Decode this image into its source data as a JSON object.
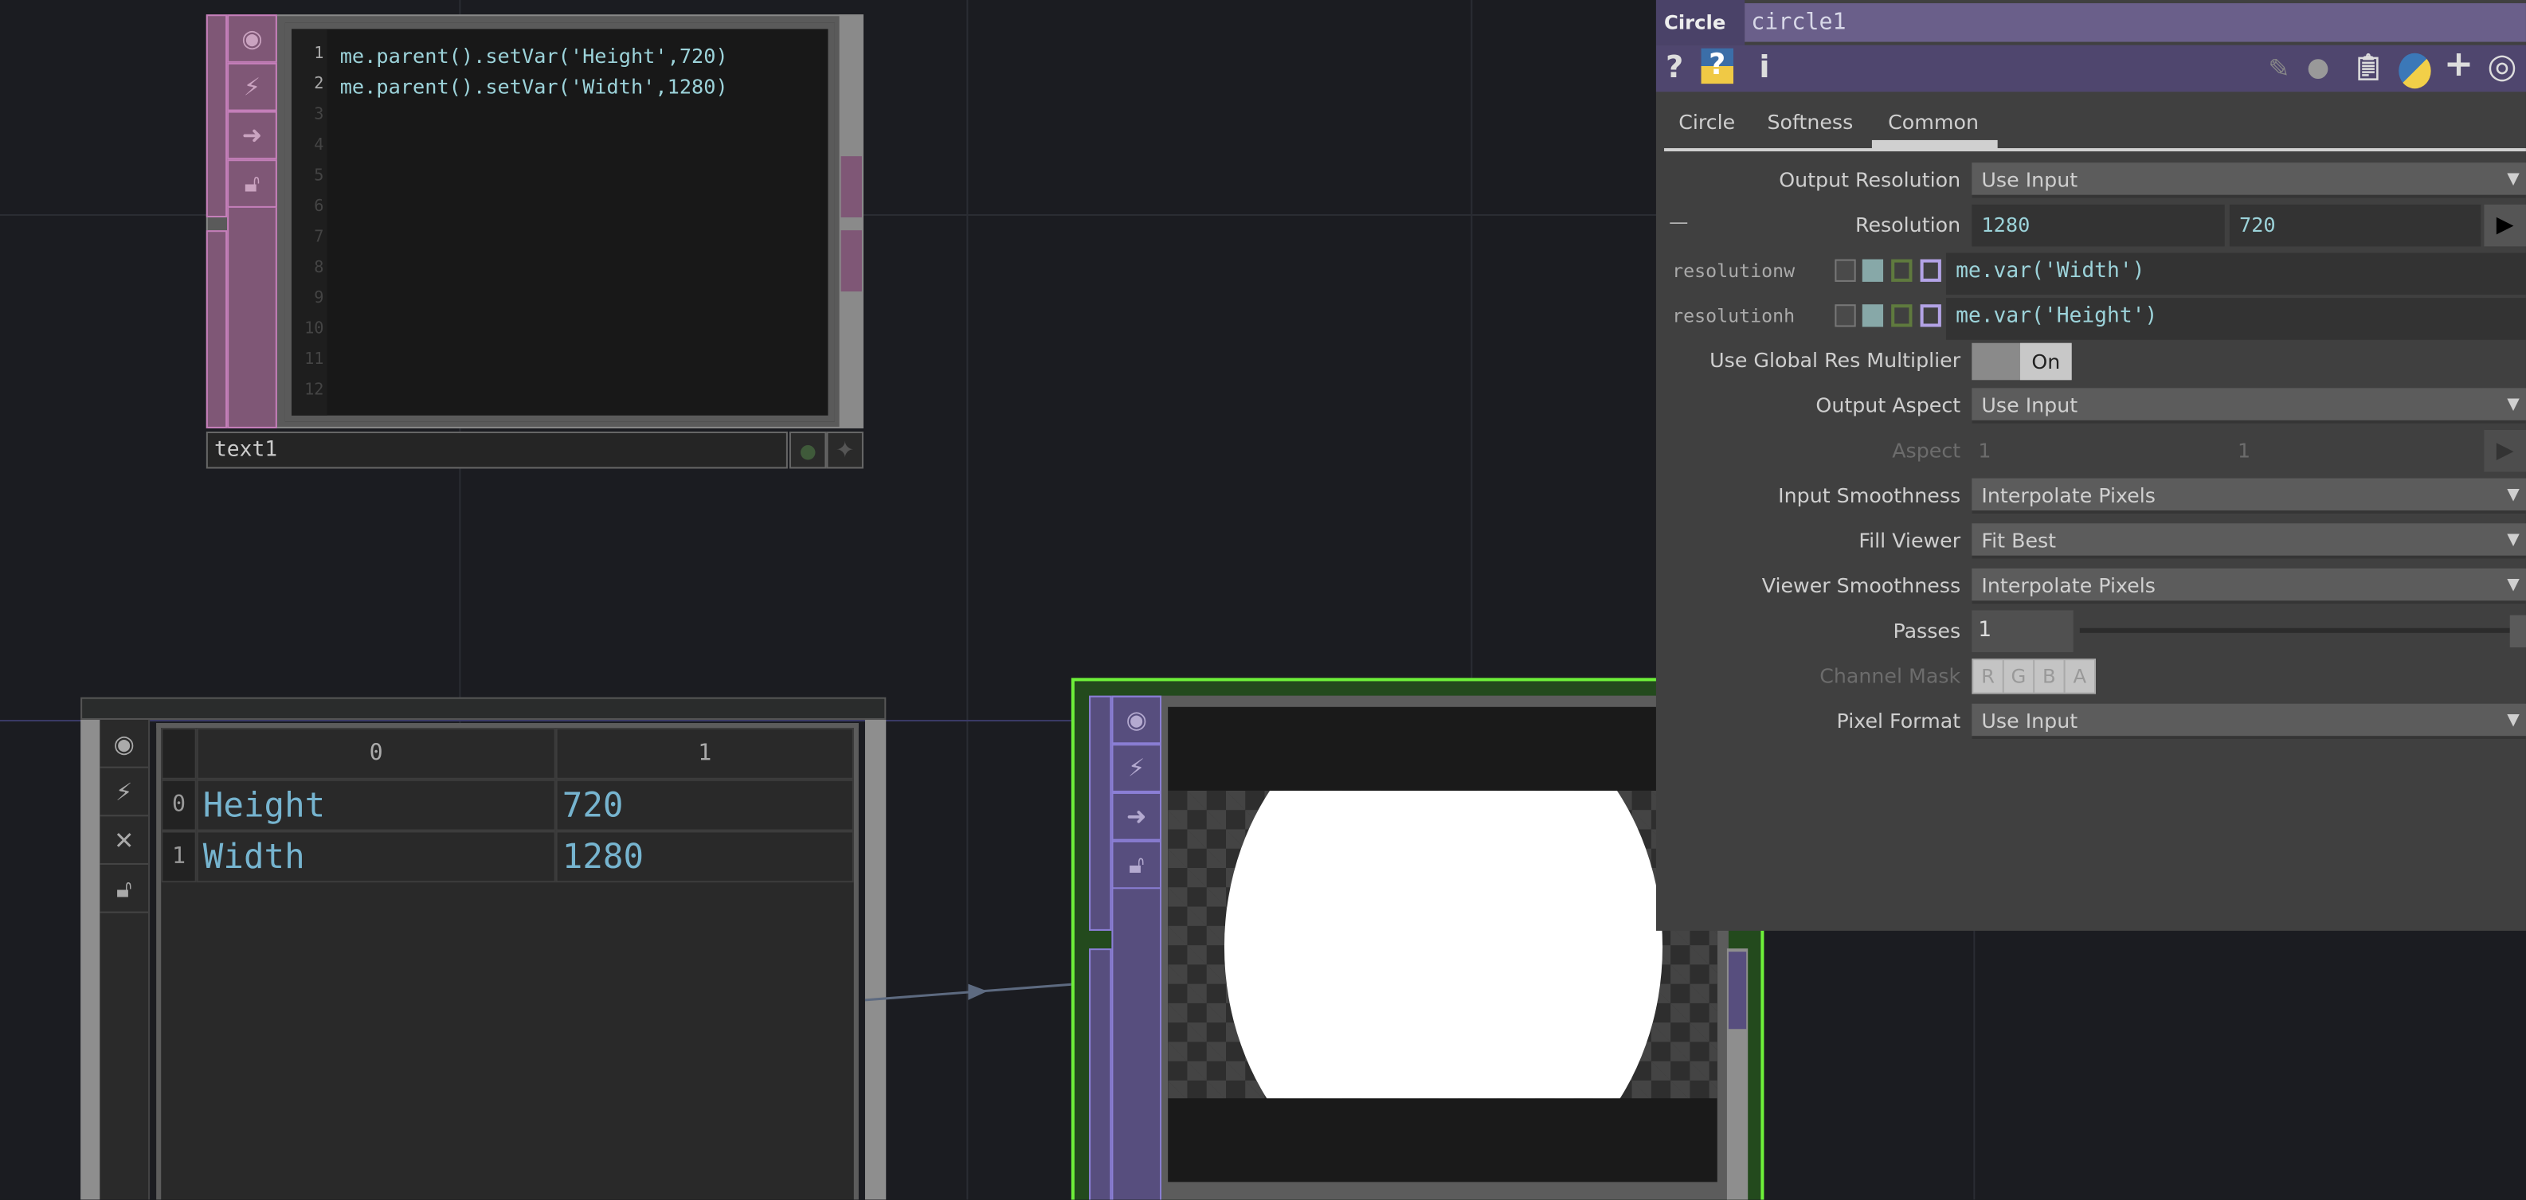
{
  "text_node": {
    "name": "text1",
    "line_numbers": [
      "1",
      "2",
      "3",
      "4",
      "5",
      "6",
      "7",
      "8",
      "9",
      "10",
      "11",
      "12"
    ],
    "lines": [
      "me.parent().setVar('Height',720)",
      "me.parent().setVar('Width',1280)"
    ]
  },
  "table_node": {
    "col_headers": [
      "0",
      "1"
    ],
    "rows": [
      {
        "index": "0",
        "cells": [
          "Height",
          "720"
        ]
      },
      {
        "index": "1",
        "cells": [
          "Width",
          "1280"
        ]
      }
    ]
  },
  "params": {
    "op_type": "Circle",
    "op_name": "circle1",
    "toolbar_left": [
      "?",
      "?",
      "i"
    ],
    "tabs": [
      "Circle",
      "Softness",
      "Common"
    ],
    "active_tab": "Common",
    "output_resolution": {
      "label": "Output Resolution",
      "value": "Use Input"
    },
    "resolution": {
      "label": "Resolution",
      "w": "1280",
      "h": "720",
      "collapse": "—"
    },
    "resolutionw": {
      "label": "resolutionw",
      "expr": "me.var('Width')"
    },
    "resolutionh": {
      "label": "resolutionh",
      "expr": "me.var('Height')"
    },
    "global_res": {
      "label": "Use Global Res Multiplier",
      "value": "On"
    },
    "output_aspect": {
      "label": "Output Aspect",
      "value": "Use Input"
    },
    "aspect": {
      "label": "Aspect",
      "a": "1",
      "b": "1"
    },
    "input_smoothness": {
      "label": "Input Smoothness",
      "value": "Interpolate Pixels"
    },
    "fill_viewer": {
      "label": "Fill Viewer",
      "value": "Fit Best"
    },
    "viewer_smoothness": {
      "label": "Viewer Smoothness",
      "value": "Interpolate Pixels"
    },
    "passes": {
      "label": "Passes",
      "value": "1"
    },
    "channel_mask": {
      "label": "Channel Mask",
      "channels": [
        "R",
        "G",
        "B",
        "A"
      ]
    },
    "pixel_format": {
      "label": "Pixel Format",
      "value": "Use Input"
    }
  },
  "colors": {
    "selected_border": "#6ef03a",
    "text_dat": "#7f5776",
    "top_op": "#574e7e",
    "param_header": "#4f466e"
  }
}
